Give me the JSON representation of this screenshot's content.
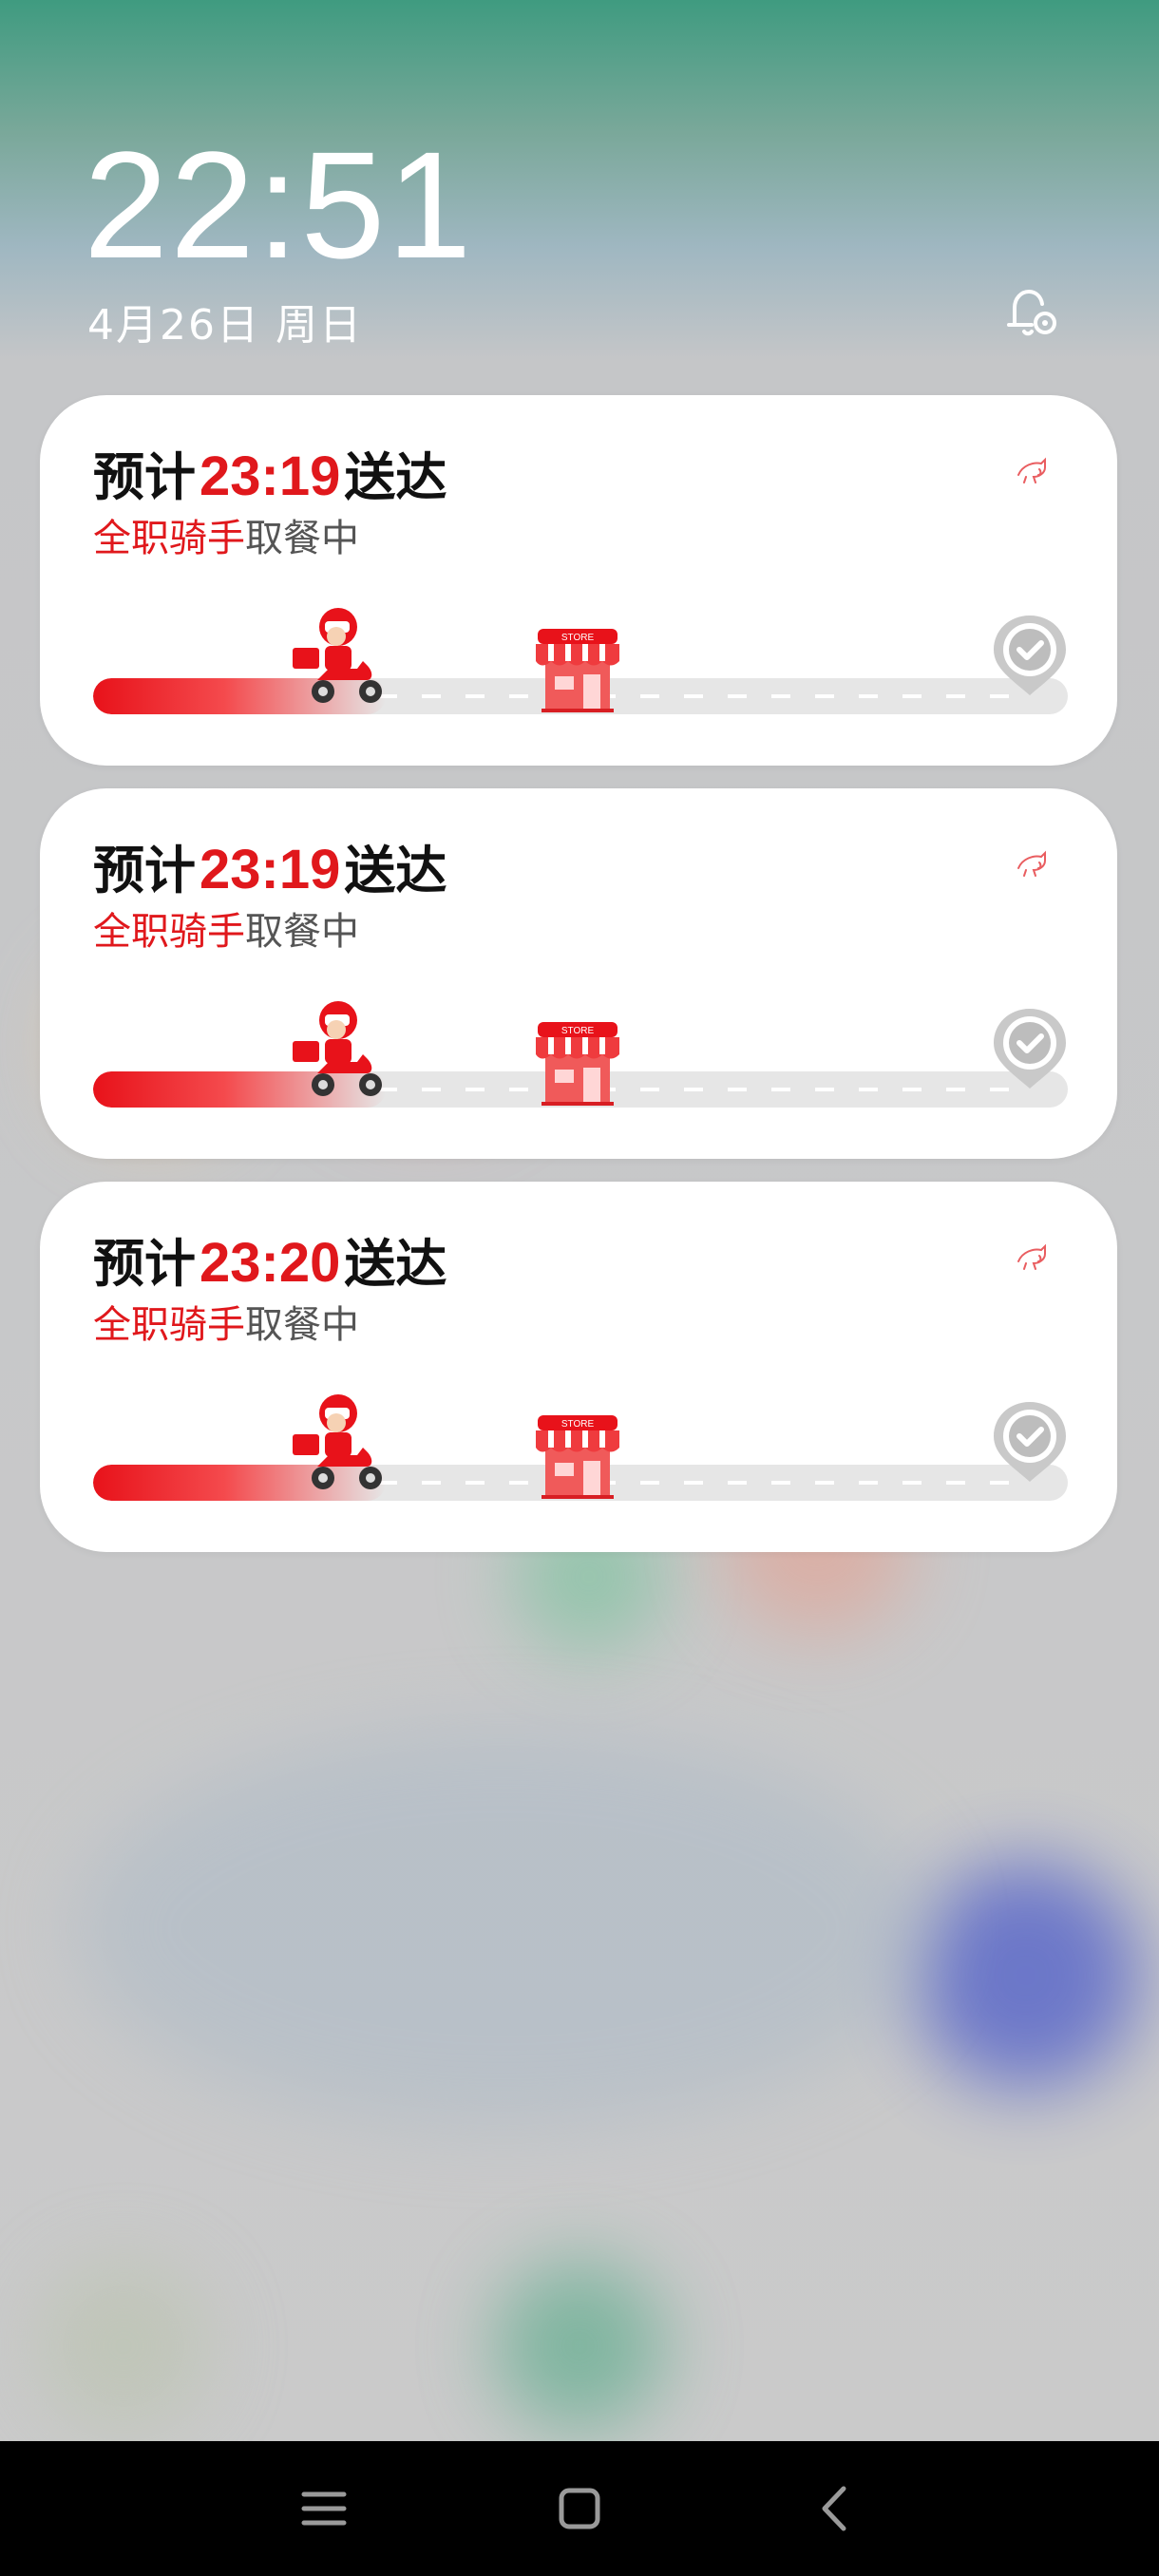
{
  "lockscreen": {
    "time": "22:51",
    "date": "4月26日 周日"
  },
  "colors": {
    "accent": "#e0181c",
    "card_bg": "#ffffff",
    "track_bg": "#e6e6e6"
  },
  "notifications": [
    {
      "prefix": "预计",
      "eta": "23:19",
      "suffix": "送达",
      "rider_type": "全职骑手",
      "status": "取餐中",
      "app_icon": "kangaroo-logo-icon",
      "progress_percent": 30
    },
    {
      "prefix": "预计",
      "eta": "23:19",
      "suffix": "送达",
      "rider_type": "全职骑手",
      "status": "取餐中",
      "app_icon": "kangaroo-logo-icon",
      "progress_percent": 30
    },
    {
      "prefix": "预计",
      "eta": "23:20",
      "suffix": "送达",
      "rider_type": "全职骑手",
      "status": "取餐中",
      "app_icon": "kangaroo-logo-icon",
      "progress_percent": 30
    }
  ],
  "store_sign": "STORE",
  "navbar": {
    "menu_icon": "menu-icon",
    "home_icon": "home-square-icon",
    "back_icon": "back-chevron-icon"
  }
}
